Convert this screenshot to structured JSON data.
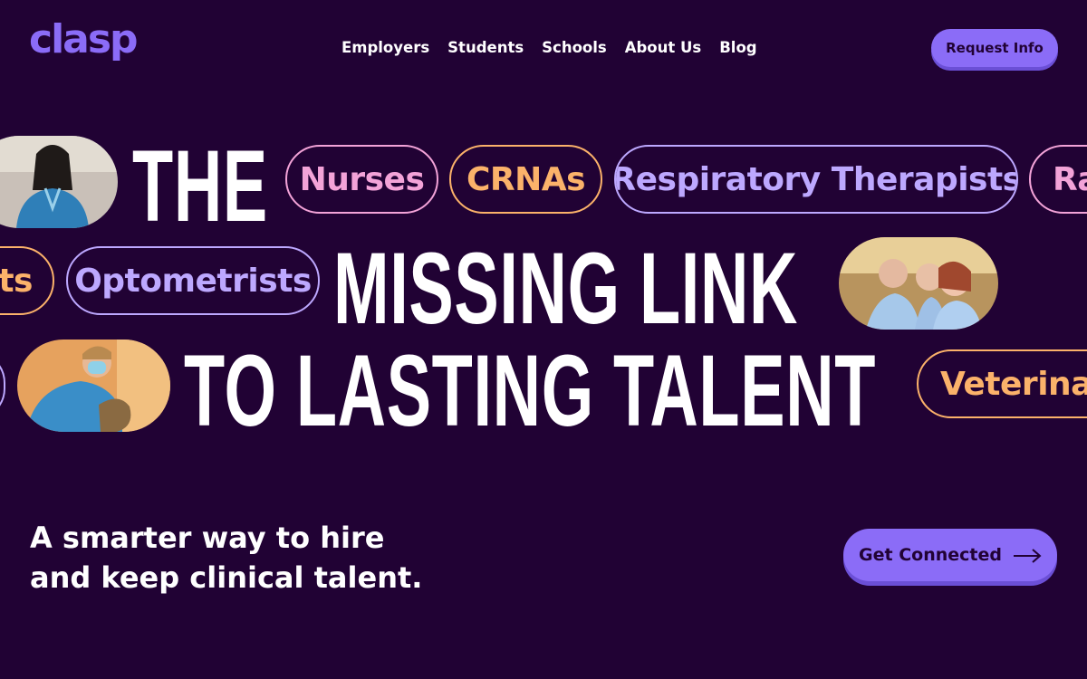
{
  "header": {
    "logo": "clasp",
    "nav": [
      "Employers",
      "Students",
      "Schools",
      "About Us",
      "Blog"
    ],
    "cta_label": "Request Info"
  },
  "hero": {
    "line1": "THE",
    "line2": "MISSING LINK",
    "line3": "TO LASTING TALENT",
    "pills": {
      "nurses": "Nurses",
      "crnas": "CRNAs",
      "respiratory": "Respiratory Therapists",
      "ra": "Ra",
      "sts": "sts",
      "optometrists": "Optometrists",
      "veterinar": "Veterinar"
    }
  },
  "footer": {
    "tagline_line1": "A smarter way to hire",
    "tagline_line2": "and keep clinical talent.",
    "connect_label": "Get Connected",
    "arrow_icon": "arrow-right-icon"
  },
  "colors": {
    "background": "#210234",
    "accent": "#8b6cf7",
    "pink": "#f3a3d8",
    "orange": "#fbb26a",
    "lavender": "#bda8ff"
  }
}
